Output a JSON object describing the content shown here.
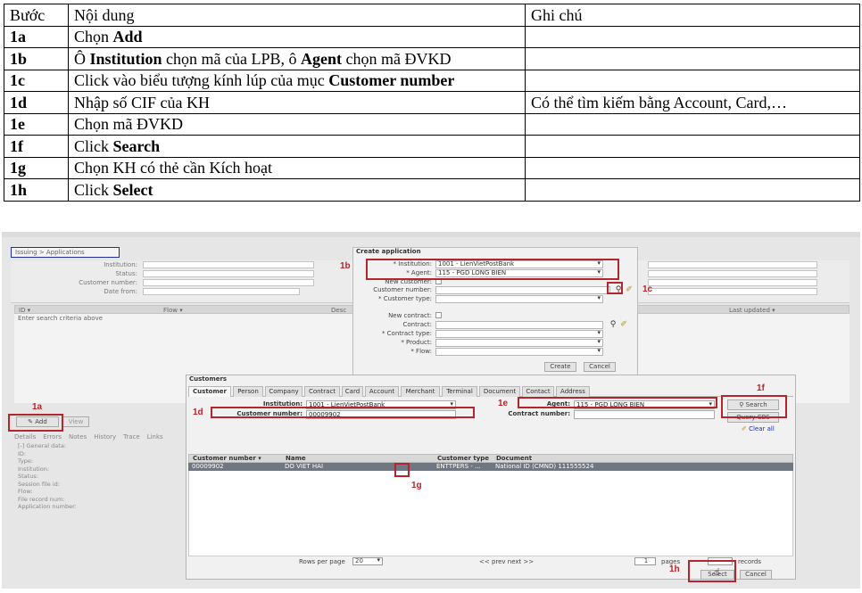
{
  "table": {
    "headers": [
      "Bước",
      "Nội dung",
      "Ghi chú"
    ],
    "rows": [
      {
        "step": "1a",
        "content": "Chọn <b>Add</b>",
        "note": ""
      },
      {
        "step": "1b",
        "content": "Ô <b>Institution</b> chọn mã của LPB, ô <b>Agent</b> chọn mã ĐVKD",
        "note": ""
      },
      {
        "step": "1c",
        "content": "Click vào biểu tượng kính lúp của mục <b>Customer number</b>",
        "note": ""
      },
      {
        "step": "1d",
        "content": "Nhập số CIF của KH",
        "note": "Có thể tìm kiếm bằng Account, Card,…"
      },
      {
        "step": "1e",
        "content": "Chọn mã ĐVKD",
        "note": ""
      },
      {
        "step": "1f",
        "content": "Click <b>Search</b>",
        "note": ""
      },
      {
        "step": "1g",
        "content": "Chọn KH có thẻ cần Kích hoạt",
        "note": ""
      },
      {
        "step": "1h",
        "content": "Click <b>Select</b>",
        "note": ""
      }
    ]
  },
  "screenshot": {
    "breadcrumb": "Issuing > Applications",
    "bg_form": {
      "institution": "Institution:",
      "status": "Status:",
      "customer_number": "Customer number:",
      "date_from": "Date from:"
    },
    "bg_grid": {
      "col_id": "ID ▾",
      "col_flow": "Flow ▾",
      "col_desc": "Desc",
      "col_updated": "Last updated ▾",
      "empty_text": "Enter search criteria above"
    },
    "add_button": "Add",
    "view_button": "View",
    "detail_tabs": [
      "Details",
      "Errors",
      "Notes",
      "History",
      "Trace",
      "Links"
    ],
    "detail_fields": [
      "[-] General data:",
      "ID:",
      "Type:",
      "Institution:",
      "Status:",
      "Session file id:",
      "Flow:",
      "File record num:",
      "Application number:"
    ],
    "create_dialog": {
      "title": "Create application",
      "institution_label": "* Institution:",
      "institution_value": "1001 - LienVietPostBank",
      "agent_label": "* Agent:",
      "agent_value": "115 - PGD LONG BIEN",
      "new_customer_label": "New customer:",
      "customer_number_label": "Customer number:",
      "customer_type_label": "* Customer type:",
      "new_contract_label": "New contract:",
      "contract_label": "Contract:",
      "contract_type_label": "* Contract type:",
      "product_label": "* Product:",
      "flow_label": "* Flow:",
      "create_button": "Create",
      "cancel_button": "Cancel"
    },
    "customers_dialog": {
      "title": "Customers",
      "tabs": [
        "Customer",
        "Person",
        "Company",
        "Contract",
        "Card",
        "Account",
        "Merchant",
        "Terminal",
        "Document",
        "Contact",
        "Address"
      ],
      "institution_label": "Institution:",
      "institution_value": "1001 - LienVietPostBank",
      "customer_number_label": "Customer number:",
      "customer_number_value": "00009902",
      "agent_label": "Agent:",
      "agent_value": "115 - PGD LONG BIEN",
      "contract_number_label": "Contract number:",
      "search_button": "Search",
      "query_cbs_button": "Query CBS",
      "clear_all": "Clear all",
      "columns": [
        "Customer number ▾",
        "Name",
        "Customer type",
        "Document"
      ],
      "row": [
        "00009902",
        "DO VIET HAI",
        "ENTTPERS - ...",
        "National ID (CMND) 111555524"
      ],
      "rows_per_page_label": "Rows per page",
      "rows_per_page_value": "20",
      "prev_next": "<< prev next >>",
      "page_value": "1",
      "pages_label": "pages",
      "records_label": "records",
      "select_button": "Select",
      "cancel_button": "Cancel"
    },
    "annotations": [
      "1a",
      "1b",
      "1c",
      "1d",
      "1e",
      "1f",
      "1g",
      "1h"
    ]
  }
}
